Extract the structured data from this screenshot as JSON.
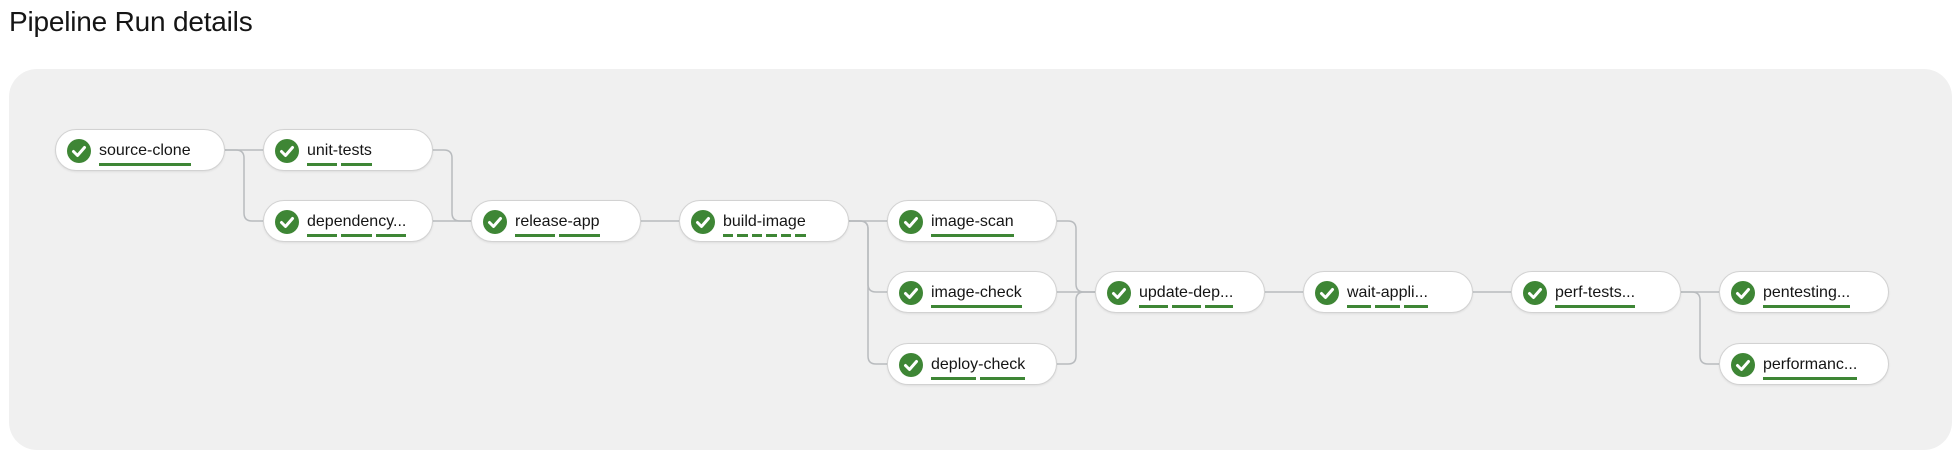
{
  "page": {
    "title": "Pipeline Run details"
  },
  "colors": {
    "success": "#3e8635",
    "canvas_bg": "#f0f0f0",
    "node_border": "#d2d2d2",
    "edge": "#b8bbbe"
  },
  "status_icon": "check-circle-icon",
  "tasks": [
    {
      "id": "source-clone",
      "label": "source-clone",
      "status": "succeeded",
      "steps": 1
    },
    {
      "id": "unit-tests",
      "label": "unit-tests",
      "status": "succeeded",
      "steps": 2
    },
    {
      "id": "dependency",
      "label": "dependency...",
      "status": "succeeded",
      "steps": 3
    },
    {
      "id": "release-app",
      "label": "release-app",
      "status": "succeeded",
      "steps": 2
    },
    {
      "id": "build-image",
      "label": "build-image",
      "status": "succeeded",
      "steps": 6
    },
    {
      "id": "image-scan",
      "label": "image-scan",
      "status": "succeeded",
      "steps": 1
    },
    {
      "id": "image-check",
      "label": "image-check",
      "status": "succeeded",
      "steps": 1
    },
    {
      "id": "deploy-check",
      "label": "deploy-check",
      "status": "succeeded",
      "steps": 2
    },
    {
      "id": "update-dep",
      "label": "update-dep...",
      "status": "succeeded",
      "steps": 3
    },
    {
      "id": "wait-appli",
      "label": "wait-appli...",
      "status": "succeeded",
      "steps": 3
    },
    {
      "id": "perf-tests",
      "label": "perf-tests...",
      "status": "succeeded",
      "steps": 1
    },
    {
      "id": "pentesting",
      "label": "pentesting...",
      "status": "succeeded",
      "steps": 1
    },
    {
      "id": "performanc",
      "label": "performanc...",
      "status": "succeeded",
      "steps": 1
    }
  ],
  "edges": [
    [
      "source-clone",
      "unit-tests"
    ],
    [
      "source-clone",
      "dependency"
    ],
    [
      "unit-tests",
      "release-app"
    ],
    [
      "dependency",
      "release-app"
    ],
    [
      "release-app",
      "build-image"
    ],
    [
      "build-image",
      "image-scan"
    ],
    [
      "build-image",
      "image-check"
    ],
    [
      "build-image",
      "deploy-check"
    ],
    [
      "image-scan",
      "update-dep"
    ],
    [
      "image-check",
      "update-dep"
    ],
    [
      "deploy-check",
      "update-dep"
    ],
    [
      "update-dep",
      "wait-appli"
    ],
    [
      "wait-appli",
      "perf-tests"
    ],
    [
      "perf-tests",
      "pentesting"
    ],
    [
      "perf-tests",
      "performanc"
    ]
  ]
}
